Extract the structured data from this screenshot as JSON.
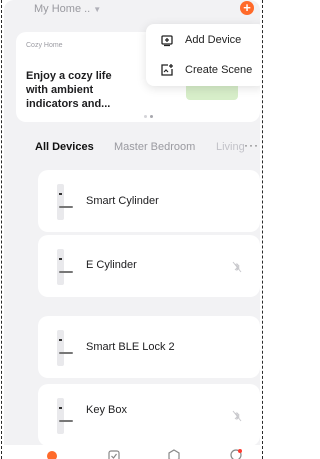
{
  "header": {
    "home_name": "My Home ..",
    "add_icon": "plus-circle-icon",
    "accent": "#ff6a2a"
  },
  "banner": {
    "kicker": "Cozy Home",
    "title": "Enjoy a cozy life with ambient indicators and...",
    "active_dot": 1,
    "dot_count": 2
  },
  "menu": {
    "items": [
      {
        "label": "Add Device",
        "icon": "add-device-icon"
      },
      {
        "label": "Create Scene",
        "icon": "create-scene-icon"
      }
    ]
  },
  "tabs": {
    "items": [
      "All Devices",
      "Master Bedroom",
      "Living"
    ],
    "active": "All Devices",
    "more_label": "···"
  },
  "devices": [
    {
      "name": "Smart Cylinder",
      "offline": false
    },
    {
      "name": "E Cylinder",
      "offline": true
    },
    {
      "name": "Smart BLE Lock 2",
      "offline": false
    },
    {
      "name": "Key Box",
      "offline": true
    }
  ],
  "bottom_nav": {
    "items": [
      "home-icon",
      "scene-icon",
      "smart-icon",
      "profile-icon"
    ],
    "active": "home-icon"
  }
}
